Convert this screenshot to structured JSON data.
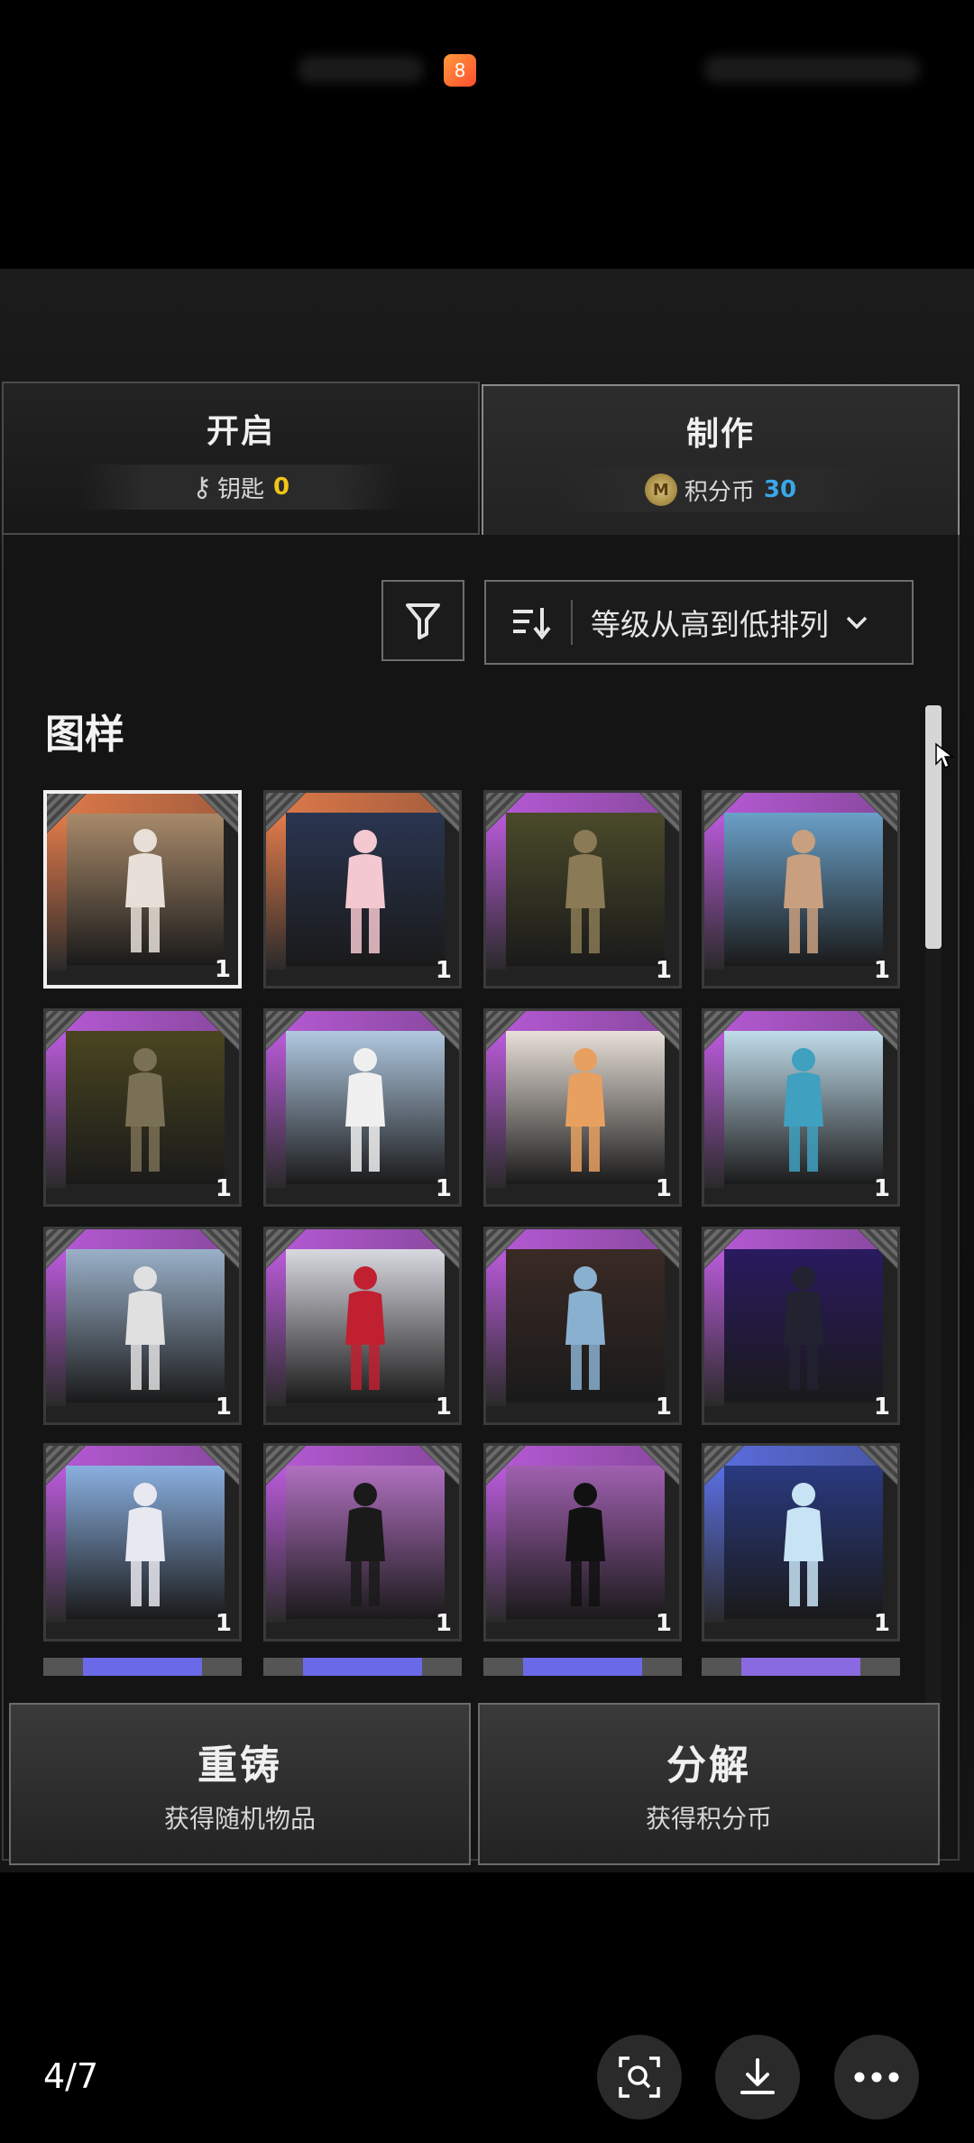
{
  "top_bar": {
    "app_badge": "8"
  },
  "tabs": {
    "open": {
      "title": "开启",
      "resource": "钥匙",
      "count": "0"
    },
    "make": {
      "title": "制作",
      "resource": "积分币",
      "count": "30"
    }
  },
  "toolbar": {
    "sort_label": "等级从高到低排列"
  },
  "section_title": "图样",
  "cards": [
    {
      "count": "1",
      "rarity": "orange",
      "art": "#a88a6a",
      "fig": "#e8e0d8"
    },
    {
      "count": "1",
      "rarity": "orange",
      "art": "#2a3550",
      "fig": "#f4c8d0"
    },
    {
      "count": "1",
      "rarity": "purple",
      "art": "#4a4a2a",
      "fig": "#8a7a55"
    },
    {
      "count": "1",
      "rarity": "purple",
      "art": "#6aa0c8",
      "fig": "#c8a080"
    },
    {
      "count": "1",
      "rarity": "purple",
      "art": "#4a4520",
      "fig": "#7a7055"
    },
    {
      "count": "1",
      "rarity": "purple",
      "art": "#b0c8e0",
      "fig": "#f0f0f0"
    },
    {
      "count": "1",
      "rarity": "purple",
      "art": "#e8e0d8",
      "fig": "#e8a060"
    },
    {
      "count": "1",
      "rarity": "purple",
      "art": "#c0dcea",
      "fig": "#40a0c0"
    },
    {
      "count": "1",
      "rarity": "purple",
      "art": "#9ab0c8",
      "fig": "#e0e0e0"
    },
    {
      "count": "1",
      "rarity": "purple",
      "art": "#d8d8e0",
      "fig": "#c02030"
    },
    {
      "count": "1",
      "rarity": "purple",
      "art": "#3a2a25",
      "fig": "#8ab0d0"
    },
    {
      "count": "1",
      "rarity": "purple",
      "art": "#2a1a60",
      "fig": "#222230"
    },
    {
      "count": "1",
      "rarity": "purple",
      "art": "#8ab0e0",
      "fig": "#e8e8f0"
    },
    {
      "count": "1",
      "rarity": "purple",
      "art": "#b070c0",
      "fig": "#1a1a1a"
    },
    {
      "count": "1",
      "rarity": "purple",
      "art": "#a060b0",
      "fig": "#111111"
    },
    {
      "count": "1",
      "rarity": "blue",
      "art": "#2a3a80",
      "fig": "#c8e4f4"
    }
  ],
  "actions": {
    "reforge": {
      "title": "重铸",
      "subtitle": "获得随机物品"
    },
    "decompose": {
      "title": "分解",
      "subtitle": "获得积分币"
    }
  },
  "viewer": {
    "page": "4/7"
  },
  "colors": {
    "orange": "#e07a4a",
    "purple": "#b85ad8",
    "blue": "#5a6ee0",
    "key_count": "#f0c419",
    "coin_count": "#3aa7e8"
  }
}
